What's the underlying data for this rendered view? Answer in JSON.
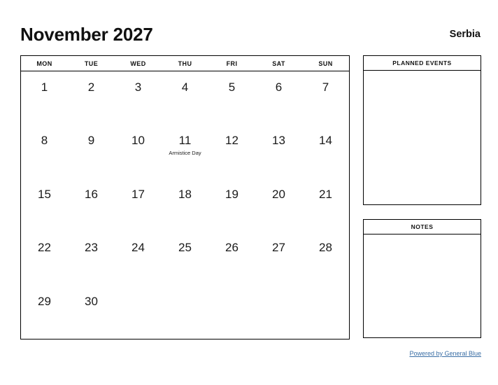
{
  "header": {
    "title": "November 2027",
    "country": "Serbia"
  },
  "calendar": {
    "weekdays": [
      "MON",
      "TUE",
      "WED",
      "THU",
      "FRI",
      "SAT",
      "SUN"
    ],
    "weeks": [
      [
        {
          "day": "1",
          "event": ""
        },
        {
          "day": "2",
          "event": ""
        },
        {
          "day": "3",
          "event": ""
        },
        {
          "day": "4",
          "event": ""
        },
        {
          "day": "5",
          "event": ""
        },
        {
          "day": "6",
          "event": ""
        },
        {
          "day": "7",
          "event": ""
        }
      ],
      [
        {
          "day": "8",
          "event": ""
        },
        {
          "day": "9",
          "event": ""
        },
        {
          "day": "10",
          "event": ""
        },
        {
          "day": "11",
          "event": "Armistice Day"
        },
        {
          "day": "12",
          "event": ""
        },
        {
          "day": "13",
          "event": ""
        },
        {
          "day": "14",
          "event": ""
        }
      ],
      [
        {
          "day": "15",
          "event": ""
        },
        {
          "day": "16",
          "event": ""
        },
        {
          "day": "17",
          "event": ""
        },
        {
          "day": "18",
          "event": ""
        },
        {
          "day": "19",
          "event": ""
        },
        {
          "day": "20",
          "event": ""
        },
        {
          "day": "21",
          "event": ""
        }
      ],
      [
        {
          "day": "22",
          "event": ""
        },
        {
          "day": "23",
          "event": ""
        },
        {
          "day": "24",
          "event": ""
        },
        {
          "day": "25",
          "event": ""
        },
        {
          "day": "26",
          "event": ""
        },
        {
          "day": "27",
          "event": ""
        },
        {
          "day": "28",
          "event": ""
        }
      ],
      [
        {
          "day": "29",
          "event": ""
        },
        {
          "day": "30",
          "event": ""
        },
        {
          "day": "",
          "event": ""
        },
        {
          "day": "",
          "event": ""
        },
        {
          "day": "",
          "event": ""
        },
        {
          "day": "",
          "event": ""
        },
        {
          "day": "",
          "event": ""
        }
      ]
    ]
  },
  "panels": {
    "planned_events": {
      "title": "PLANNED EVENTS",
      "content": ""
    },
    "notes": {
      "title": "NOTES",
      "content": ""
    }
  },
  "footer": {
    "link_text": "Powered by General Blue",
    "link_color": "#3a6ea5"
  }
}
